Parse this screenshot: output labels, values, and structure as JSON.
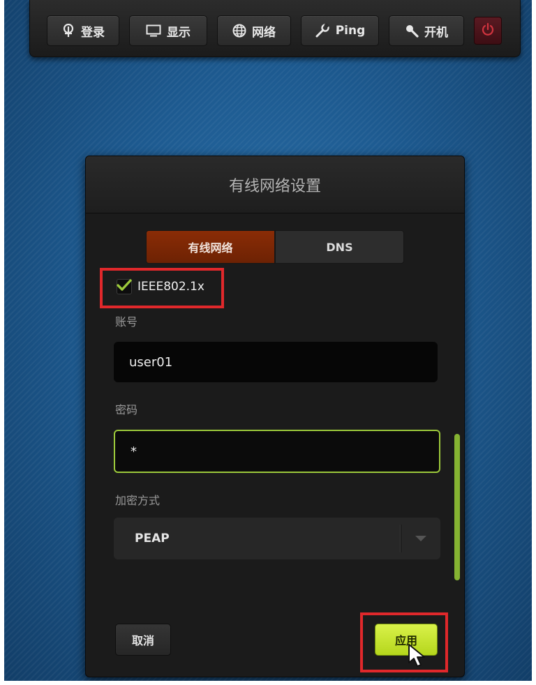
{
  "toolbar": {
    "items": [
      {
        "label": "登录",
        "icon": "login-icon"
      },
      {
        "label": "显示",
        "icon": "display-icon"
      },
      {
        "label": "网络",
        "icon": "globe-icon"
      },
      {
        "label": "Ping",
        "icon": "wrench-icon"
      },
      {
        "label": "开机",
        "icon": "wake-icon"
      }
    ],
    "power_icon": "power-icon"
  },
  "dialog": {
    "title": "有线网络设置",
    "tabs": [
      {
        "label": "有线网络",
        "active": true
      },
      {
        "label": "DNS",
        "active": false
      }
    ],
    "checkbox": {
      "label": "IEEE802.1x",
      "checked": true
    },
    "account": {
      "label": "账号",
      "value": "user01"
    },
    "password": {
      "label": "密码",
      "value": "*"
    },
    "encryption": {
      "label": "加密方式",
      "value": "PEAP"
    },
    "cancel_label": "取消",
    "apply_label": "应用"
  },
  "colors": {
    "accent_green": "#b5d61c",
    "tab_active": "#7a2705",
    "highlight_red": "#e0282b",
    "focus_border": "#9cc93b"
  }
}
